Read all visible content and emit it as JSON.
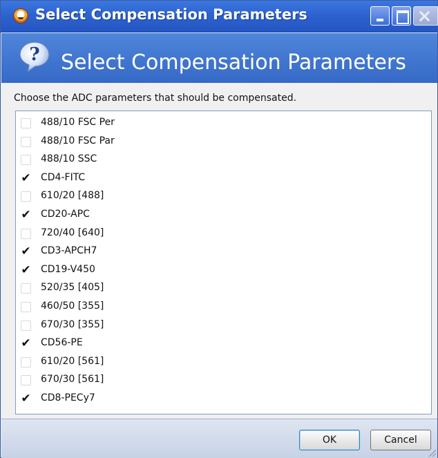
{
  "window": {
    "title": "Select Compensation Parameters"
  },
  "header": {
    "title": "Select Compensation Parameters",
    "icon": "help-question-icon"
  },
  "instruction": "Choose the ADC parameters that should be compensated.",
  "parameters": [
    {
      "label": "488/10 FSC Per",
      "checked": false
    },
    {
      "label": "488/10 FSC Par",
      "checked": false
    },
    {
      "label": "488/10 SSC",
      "checked": false
    },
    {
      "label": "CD4-FITC",
      "checked": true
    },
    {
      "label": "610/20 [488]",
      "checked": false
    },
    {
      "label": "CD20-APC",
      "checked": true
    },
    {
      "label": "720/40 [640]",
      "checked": false
    },
    {
      "label": "CD3-APCH7",
      "checked": true
    },
    {
      "label": "CD19-V450",
      "checked": true
    },
    {
      "label": "520/35 [405]",
      "checked": false
    },
    {
      "label": "460/50 [355]",
      "checked": false
    },
    {
      "label": "670/30 [355]",
      "checked": false
    },
    {
      "label": "CD56-PE",
      "checked": true
    },
    {
      "label": "610/20 [561]",
      "checked": false
    },
    {
      "label": "670/30 [561]",
      "checked": false
    },
    {
      "label": "CD8-PECy7",
      "checked": true
    }
  ],
  "buttons": {
    "ok": "OK",
    "cancel": "Cancel"
  },
  "colors": {
    "titlebar": "#2d63cf",
    "header": "#3f74cf",
    "body": "#f0f0f0"
  }
}
